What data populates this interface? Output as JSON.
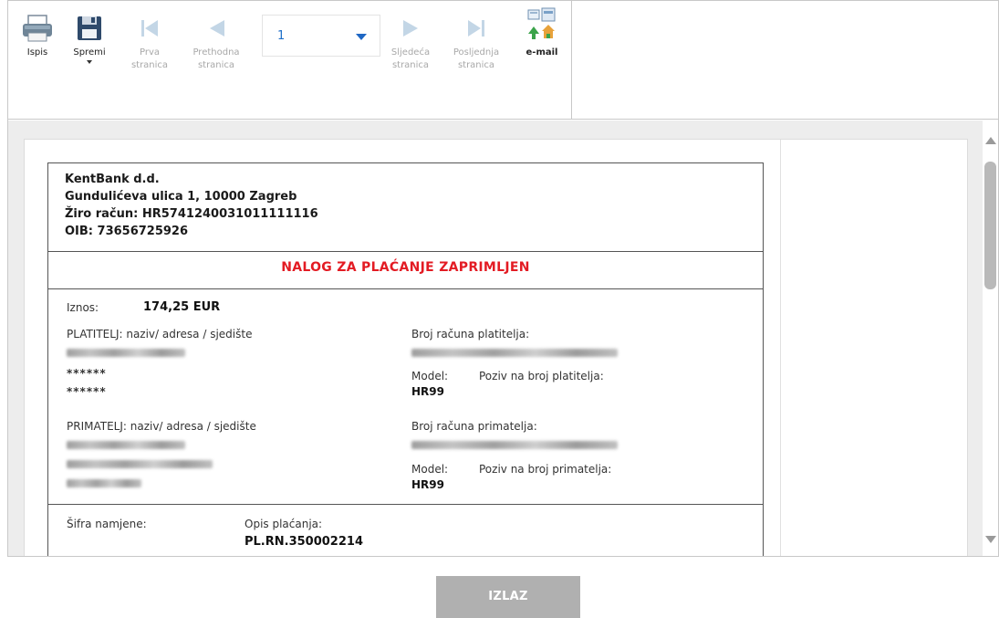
{
  "toolbar": {
    "print_label": "Ispis",
    "save_label": "Spremi",
    "first_label_1": "Prva",
    "first_label_2": "stranica",
    "prev_label_1": "Prethodna",
    "prev_label_2": "stranica",
    "page_value": "1",
    "next_label_1": "Sljedeća",
    "next_label_2": "stranica",
    "last_label_1": "Posljednja",
    "last_label_2": "stranica",
    "email_label": "e-mail"
  },
  "bank": {
    "name": "KentBank d.d.",
    "address": "Gundulićeva ulica 1, 10000 Zagreb",
    "account": "Žiro račun: HR5741240031011111116",
    "oib": "OIB: 73656725926"
  },
  "status_title": "NALOG ZA PLAĆANJE ZAPRIMLJEN",
  "payment": {
    "amount_label": "Iznos:",
    "amount_value": "174,25 EUR",
    "payer_label": "PLATITELJ: naziv/ adresa / sjedište",
    "payer_masked_1": "******",
    "payer_masked_2": "******",
    "payer_account_label": "Broj računa platitelja:",
    "payer_model_label": "Model:",
    "payer_ref_label": "Poziv na broj platitelja:",
    "payer_model_value": "HR99",
    "payee_label": "PRIMATELJ: naziv/ adresa / sjedište",
    "payee_account_label": "Broj računa primatelja:",
    "payee_model_label": "Model:",
    "payee_ref_label": "Poziv na broj primatelja:",
    "payee_model_value": "HR99",
    "purpose_code_label": "Šifra namjene:",
    "description_label": "Opis plaćanja:",
    "description_value": "PL.RN.350002214"
  },
  "exit_label": "IZLAZ",
  "colors": {
    "status_red": "#e31b23",
    "accent_blue": "#1f67c4",
    "exit_button": "#b0b0b0"
  }
}
